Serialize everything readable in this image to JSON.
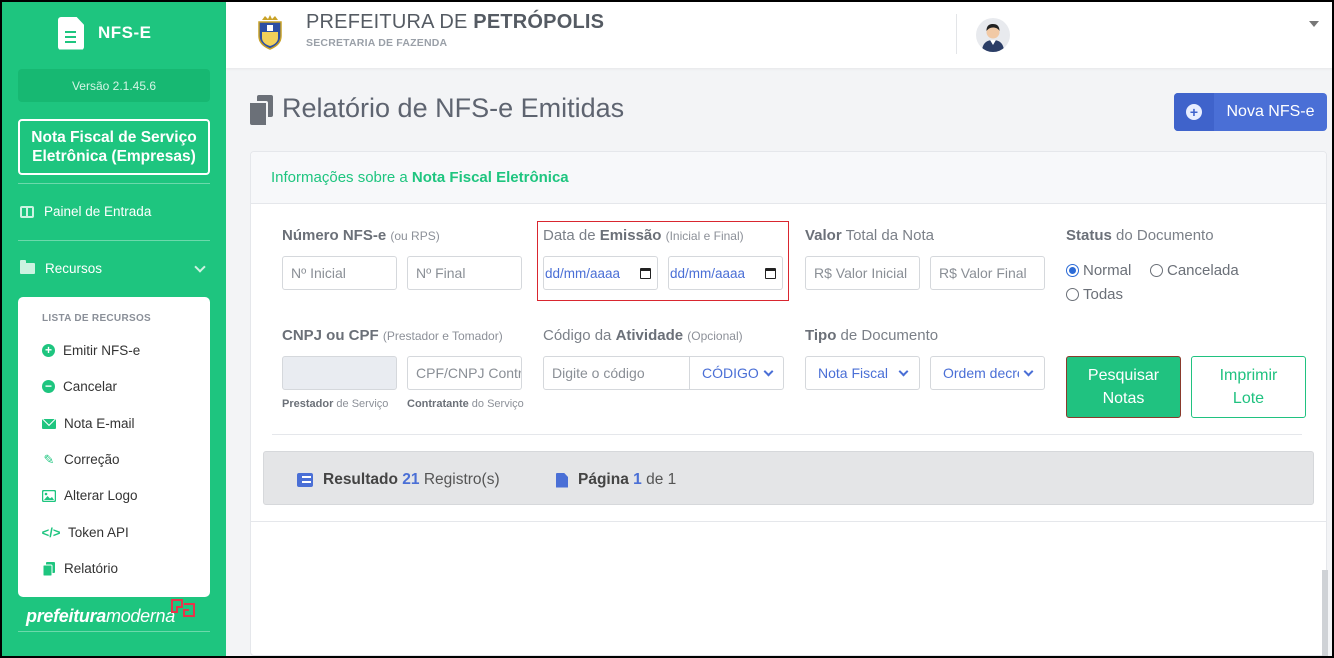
{
  "sidebar": {
    "brand": "NFS-E",
    "version": "Versão 2.1.45.6",
    "product": "Nota Fiscal de Serviço Eletrônica (Empresas)",
    "painel": "Painel de Entrada",
    "recursos": "Recursos",
    "menu_header": "LISTA DE RECURSOS",
    "menu": [
      "Emitir NFS-e",
      "Cancelar",
      "Nota E-mail",
      "Correção",
      "Alterar Logo",
      "Token API",
      "Relatório"
    ],
    "footer_logo_bold": "prefeitura",
    "footer_logo_rest": "moderna"
  },
  "header": {
    "city_prefix": "PREFEITURA DE ",
    "city_name": "PETRÓPOLIS",
    "department": "SECRETARIA DE FAZENDA"
  },
  "page": {
    "title": "Relatório de NFS-e Emitidas",
    "new_button": "Nova NFS-e"
  },
  "card": {
    "info_prefix": "Informações sobre a ",
    "info_bold": "Nota Fiscal Eletrônica"
  },
  "form": {
    "numero_label": "Número NFS-e",
    "numero_hint": "(ou RPS)",
    "numero_inicial": "Nº Inicial",
    "numero_final": "Nº Final",
    "data_label_a": "Data de ",
    "data_label_b": "Emissão",
    "data_hint": "(Inicial e Final)",
    "date_placeholder": "dd/mm/aaaa",
    "valor_label_a": "Valor",
    "valor_label_b": " Total da Nota",
    "valor_inicial": "R$ Valor Inicial",
    "valor_final": "R$ Valor Final",
    "status_label_a": "Status",
    "status_label_b": " do Documento",
    "status_options": [
      "Normal",
      "Cancelada",
      "Todas"
    ],
    "status_selected": "Normal",
    "cnpj_label": "CNPJ ou CPF",
    "cnpj_hint": "(Prestador e Tomador)",
    "cnpj_contratante": "CPF/CNPJ Contratante",
    "prestador_sub_b": "Prestador",
    "prestador_sub": " de Serviço",
    "contratante_sub_b": "Contratante",
    "contratante_sub": " do Serviço",
    "atividade_label_a": "Código da ",
    "atividade_label_b": "Atividade",
    "atividade_hint": "(Opcional)",
    "atividade_placeholder": "Digite o código",
    "atividade_select": "CÓDIGO",
    "tipo_label_a": "Tipo",
    "tipo_label_b": " de Documento",
    "tipo_select": "Nota Fiscal",
    "ordem_select": "Ordem decrescente",
    "search_button_l1": "Pesquisar",
    "search_button_l2": "Notas",
    "print_button_l1": "Imprimir",
    "print_button_l2": "Lote"
  },
  "result": {
    "label": "Resultado",
    "count": "21",
    "suffix": "Registro(s)",
    "page_label": "Página",
    "page_current": "1",
    "page_of": "de 1"
  },
  "colors": {
    "sidebar_green": "#1ec57f",
    "primary_blue": "#4a6fd6",
    "highlight_red": "#d9262f"
  }
}
